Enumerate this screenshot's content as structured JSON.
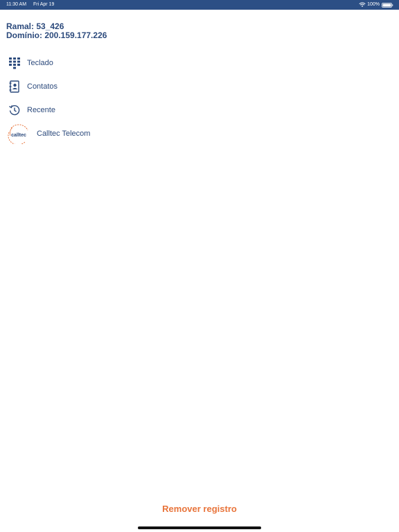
{
  "status_bar": {
    "time": "11:30 AM",
    "date": "Fri Apr 19",
    "battery": "100%"
  },
  "account": {
    "ramal": "Ramal: 53_426",
    "dominio": "Domínio: 200.159.177.226"
  },
  "menu": {
    "items": [
      {
        "label": "Teclado",
        "icon": "keypad-icon"
      },
      {
        "label": "Contatos",
        "icon": "contacts-book-icon"
      },
      {
        "label": "Recente",
        "icon": "history-clock-icon"
      },
      {
        "label": "Calltec Telecom",
        "icon": "calltec-logo"
      }
    ]
  },
  "logo_text": "calltec",
  "footer": {
    "remove_label": "Remover registro"
  },
  "colors": {
    "status_bar": "#2c4f85",
    "text_primary": "#2c4a7c",
    "accent": "#e8743b"
  }
}
